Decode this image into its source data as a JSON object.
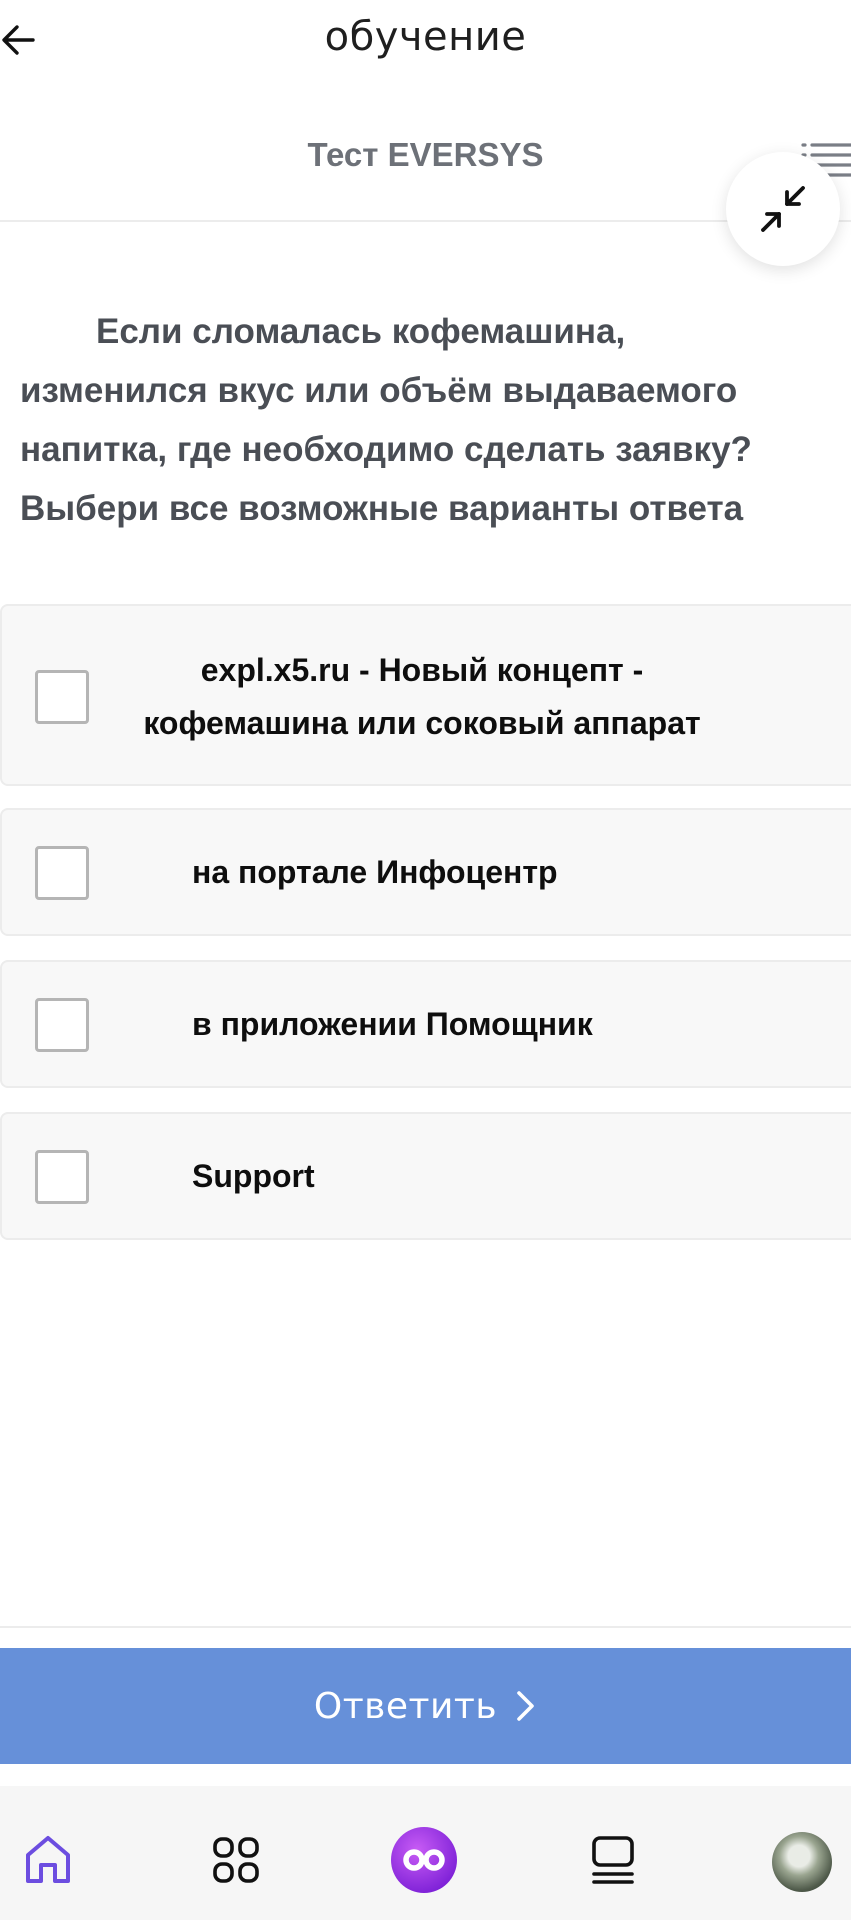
{
  "header": {
    "title": "обучение",
    "back_icon": "arrow-left-icon"
  },
  "subheader": {
    "test_title": "Тест EVERSYS",
    "list_icon": "list-icon",
    "collapse_icon": "collapse-arrows-icon"
  },
  "question": {
    "text": "Если сломалась кофемашина, изменился вкус или объём выдаваемого напитка, где необходимо сделать заявку? Выбери все возможные варианты ответа"
  },
  "options": [
    {
      "line1": "expl.x5.ru - Новый концепт -",
      "line2": "кофемашина или соковый аппарат",
      "checked": false
    },
    {
      "label": "на портале Инфоцентр",
      "checked": false
    },
    {
      "label": "в приложении Помощник",
      "checked": false
    },
    {
      "label": "Support",
      "checked": false
    }
  ],
  "submit": {
    "label": "Ответить",
    "icon": "chevron-right-icon",
    "color": "#6690d9"
  },
  "bottom_nav": {
    "items": [
      {
        "icon": "home-icon",
        "active": true,
        "color": "#6c4de0"
      },
      {
        "icon": "apps-grid-icon",
        "active": false
      },
      {
        "icon": "infinity-logo-icon",
        "active": false,
        "color": "#8a2be2"
      },
      {
        "icon": "courses-icon",
        "active": false
      },
      {
        "icon": "profile-avatar",
        "active": false
      }
    ]
  }
}
